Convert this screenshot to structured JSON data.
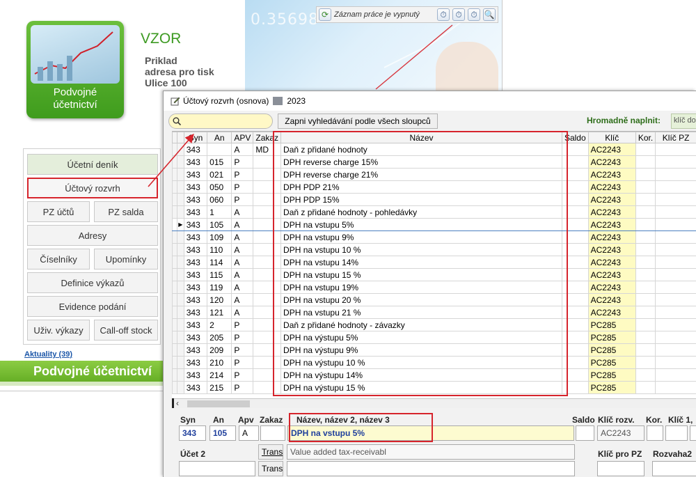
{
  "status": {
    "text": "Záznam práce je vypnutý",
    "icons": [
      "stopwatch-icon",
      "stopwatch-icon",
      "stopwatch-icon",
      "report-search-icon"
    ]
  },
  "hero": {
    "number": "0.35698"
  },
  "logo": {
    "caption_line1": "Podvojné",
    "caption_line2": "účetnictví"
  },
  "company": {
    "name": "VZOR",
    "address_line1": "Priklad",
    "address_line2": "adresa pro tisk",
    "address_line3": "Ulice 100"
  },
  "menu": {
    "accounting_journal": "Účetní deník",
    "chart_of_accounts": "Účtový rozvrh",
    "pz_accounts": "PZ účtů",
    "pz_balance": "PZ salda",
    "addresses": "Adresy",
    "codebooks": "Číselníky",
    "reminders": "Upomínky",
    "report_definitions": "Definice výkazů",
    "filing_records": "Evidence podání",
    "user_reports": "Uživ. výkazy",
    "call_off_stock": "Call-off stock"
  },
  "news": {
    "label": "Aktuality (39)"
  },
  "app_banner": {
    "title": "Podvojné účetnictví"
  },
  "dialog": {
    "title": "Účtový rozvrh (osnova)",
    "year": "2023",
    "search_value": "",
    "search_all_button": "Zapni vyhledávání podle všech sloupců",
    "bulk_fill_label": "Hromadně naplnit:",
    "bulk_fill_value": "klíč do"
  },
  "grid": {
    "headers": {
      "syn": "Syn",
      "an": "An",
      "apv": "APV",
      "zakaz": "Zakaz",
      "nazev": "Název",
      "saldo": "Saldo",
      "klic": "Klíč",
      "kor": "Kor.",
      "klic_pz": "Klíč PZ"
    },
    "rows": [
      {
        "syn": "343",
        "an": "",
        "apv": "A",
        "zakaz": "MD",
        "nazev": "Daň z přidané hodnoty",
        "klic": "AC2243"
      },
      {
        "syn": "343",
        "an": "015",
        "apv": "P",
        "zakaz": "",
        "nazev": "DPH reverse charge 15%",
        "klic": "AC2243"
      },
      {
        "syn": "343",
        "an": "021",
        "apv": "P",
        "zakaz": "",
        "nazev": "DPH reverse charge 21%",
        "klic": "AC2243"
      },
      {
        "syn": "343",
        "an": "050",
        "apv": "P",
        "zakaz": "",
        "nazev": "DPH PDP 21%",
        "klic": "AC2243"
      },
      {
        "syn": "343",
        "an": "060",
        "apv": "P",
        "zakaz": "",
        "nazev": "DPH PDP 15%",
        "klic": "AC2243"
      },
      {
        "syn": "343",
        "an": "1",
        "apv": "A",
        "zakaz": "",
        "nazev": "Daň z přidané hodnoty - pohledávky",
        "klic": "AC2243"
      },
      {
        "syn": "343",
        "an": "105",
        "apv": "A",
        "zakaz": "",
        "nazev": "DPH na vstupu 5%",
        "klic": "AC2243"
      },
      {
        "syn": "343",
        "an": "109",
        "apv": "A",
        "zakaz": "",
        "nazev": "DPH na vstupu 9%",
        "klic": "AC2243"
      },
      {
        "syn": "343",
        "an": "110",
        "apv": "A",
        "zakaz": "",
        "nazev": "DPH na vstupu 10 %",
        "klic": "AC2243"
      },
      {
        "syn": "343",
        "an": "114",
        "apv": "A",
        "zakaz": "",
        "nazev": "DPH na vstupu 14%",
        "klic": "AC2243"
      },
      {
        "syn": "343",
        "an": "115",
        "apv": "A",
        "zakaz": "",
        "nazev": "DPH na vstupu 15 %",
        "klic": "AC2243"
      },
      {
        "syn": "343",
        "an": "119",
        "apv": "A",
        "zakaz": "",
        "nazev": "DPH na vstupu 19%",
        "klic": "AC2243"
      },
      {
        "syn": "343",
        "an": "120",
        "apv": "A",
        "zakaz": "",
        "nazev": "DPH na vstupu 20 %",
        "klic": "AC2243"
      },
      {
        "syn": "343",
        "an": "121",
        "apv": "A",
        "zakaz": "",
        "nazev": "DPH na vstupu 21 %",
        "klic": "AC2243"
      },
      {
        "syn": "343",
        "an": "2",
        "apv": "P",
        "zakaz": "",
        "nazev": "Daň z přidané hodnoty - závazky",
        "klic": "PC285"
      },
      {
        "syn": "343",
        "an": "205",
        "apv": "P",
        "zakaz": "",
        "nazev": "DPH na výstupu 5%",
        "klic": "PC285"
      },
      {
        "syn": "343",
        "an": "209",
        "apv": "P",
        "zakaz": "",
        "nazev": "DPH na výstupu 9%",
        "klic": "PC285"
      },
      {
        "syn": "343",
        "an": "210",
        "apv": "P",
        "zakaz": "",
        "nazev": "DPH na výstupu 10 %",
        "klic": "PC285"
      },
      {
        "syn": "343",
        "an": "214",
        "apv": "P",
        "zakaz": "",
        "nazev": "DPH na výstupu 14%",
        "klic": "PC285"
      },
      {
        "syn": "343",
        "an": "215",
        "apv": "P",
        "zakaz": "",
        "nazev": "DPH na výstupu 15 %",
        "klic": "PC285"
      }
    ]
  },
  "detail": {
    "labels": {
      "syn": "Syn",
      "an": "An",
      "apv": "Apv",
      "zakaz": "Zakaz",
      "nazev": "Název, název 2, název 3",
      "saldo": "Saldo",
      "klic_rozv": "Klíč rozv.",
      "kor": "Kor.",
      "klic1": "Klíč 1,",
      "ucet2": "Účet 2",
      "klic_pz": "Klíč pro PZ",
      "rozvaha2": "Rozvaha2"
    },
    "values": {
      "syn": "343",
      "an": "105",
      "apv": "A",
      "zakaz": "",
      "nazev": "DPH na vstupu 5%",
      "nazev2": "Value added tax-receivabl",
      "nazev3": "",
      "klic_rozv": "AC2243",
      "ucet2": ""
    },
    "trans_label": "Trans"
  },
  "colors": {
    "accent_red": "#d6242c",
    "key_yellow": "#fefbc2",
    "brand_green": "#3d9a22"
  }
}
